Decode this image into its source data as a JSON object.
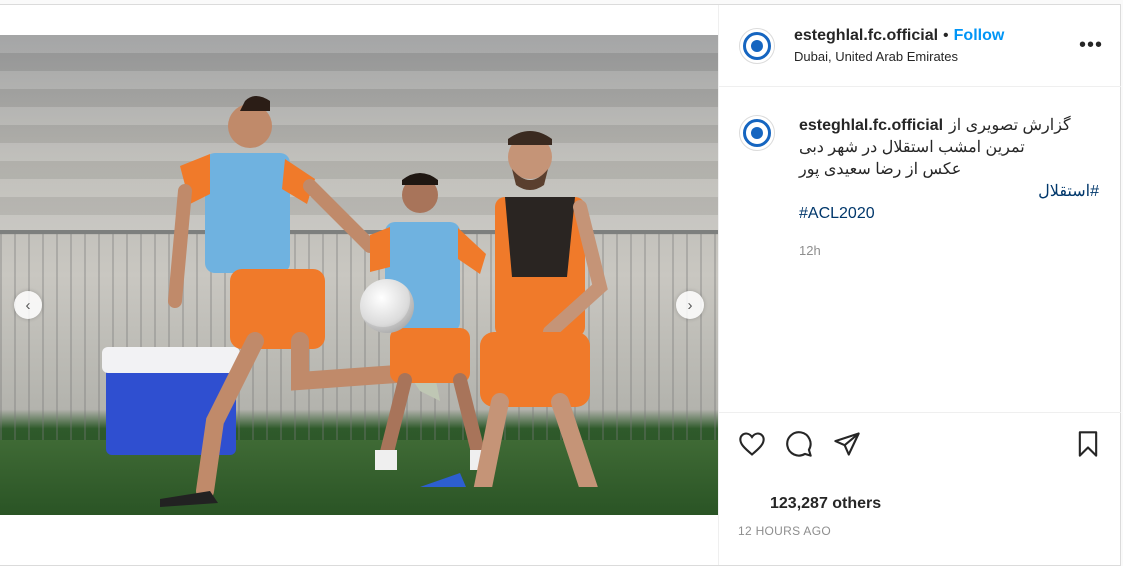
{
  "post": {
    "username": "esteghlal.fc.official",
    "separator": "•",
    "follow_label": "Follow",
    "location": "Dubai, United Arab Emirates",
    "more_label": "•••"
  },
  "caption": {
    "username": "esteghlal.fc.official",
    "line1": "گزارش تصویری از",
    "line2": "تمرین امشب استقلال در شهر دبی",
    "line3": "عکس از رضا سعیدی پور",
    "hashtags": [
      "#استقلال",
      "#ACL2020"
    ],
    "time": "12h"
  },
  "carousel": {
    "prev_label": "‹",
    "next_label": "›",
    "dot_count": 10,
    "active_index": 8
  },
  "engagement": {
    "likes": "123,287 others",
    "time_ago": "12 HOURS AGO"
  },
  "icons": {
    "like": "heart-icon",
    "comment": "comment-icon",
    "share": "share-icon",
    "save": "bookmark-icon"
  },
  "colors": {
    "follow": "#0095f6",
    "hashtag": "#00376b",
    "muted": "#8e8e8e",
    "brand_blue": "#1565c0"
  }
}
